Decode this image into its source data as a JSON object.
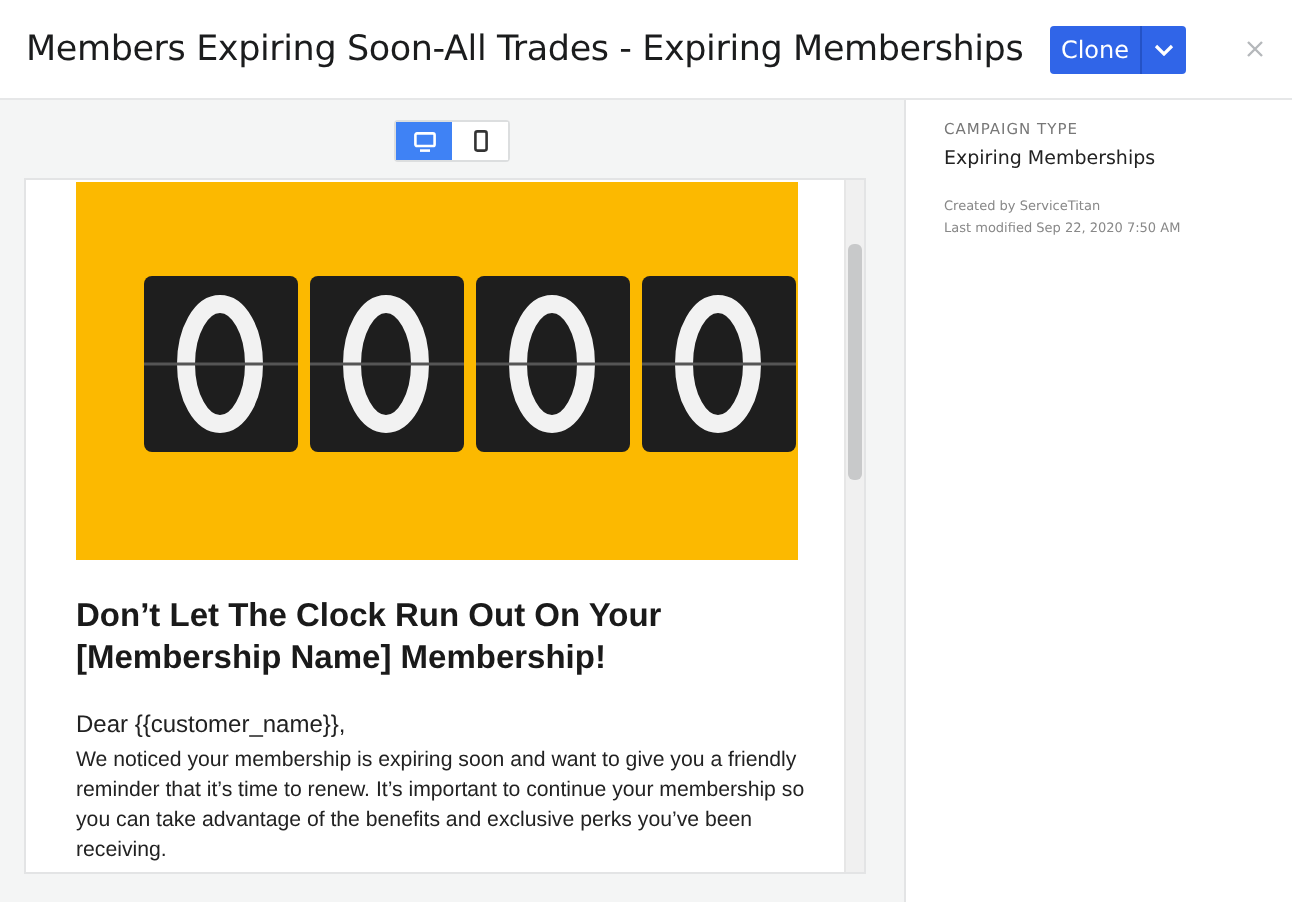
{
  "window": {
    "title": "Members Expiring Soon-All Trades - Expiring Memberships"
  },
  "header_actions": {
    "clone_button": "Clone"
  },
  "view_toggle": [
    {
      "kind": "desktop",
      "selected": true
    },
    {
      "kind": "mobile",
      "selected": false
    }
  ],
  "email_preview": {
    "heading": "Don’t Let The Clock Run Out On Your [Membership Name] Membership!",
    "greeting": "Dear {{customer_name}},",
    "body": "We noticed your membership is expiring soon and want to give you a friendly reminder that it’s time to renew. It’s important to continue your membership so you can take advantage of the benefits and exclusive perks you’ve been receiving."
  },
  "details": {
    "campaign_type_label": "CAMPAIGN TYPE",
    "campaign_type": "Expiring Memberships",
    "created_by": "Created by ServiceTitan",
    "last_modified": "Last modified Sep 22, 2020 7:50 AM"
  }
}
